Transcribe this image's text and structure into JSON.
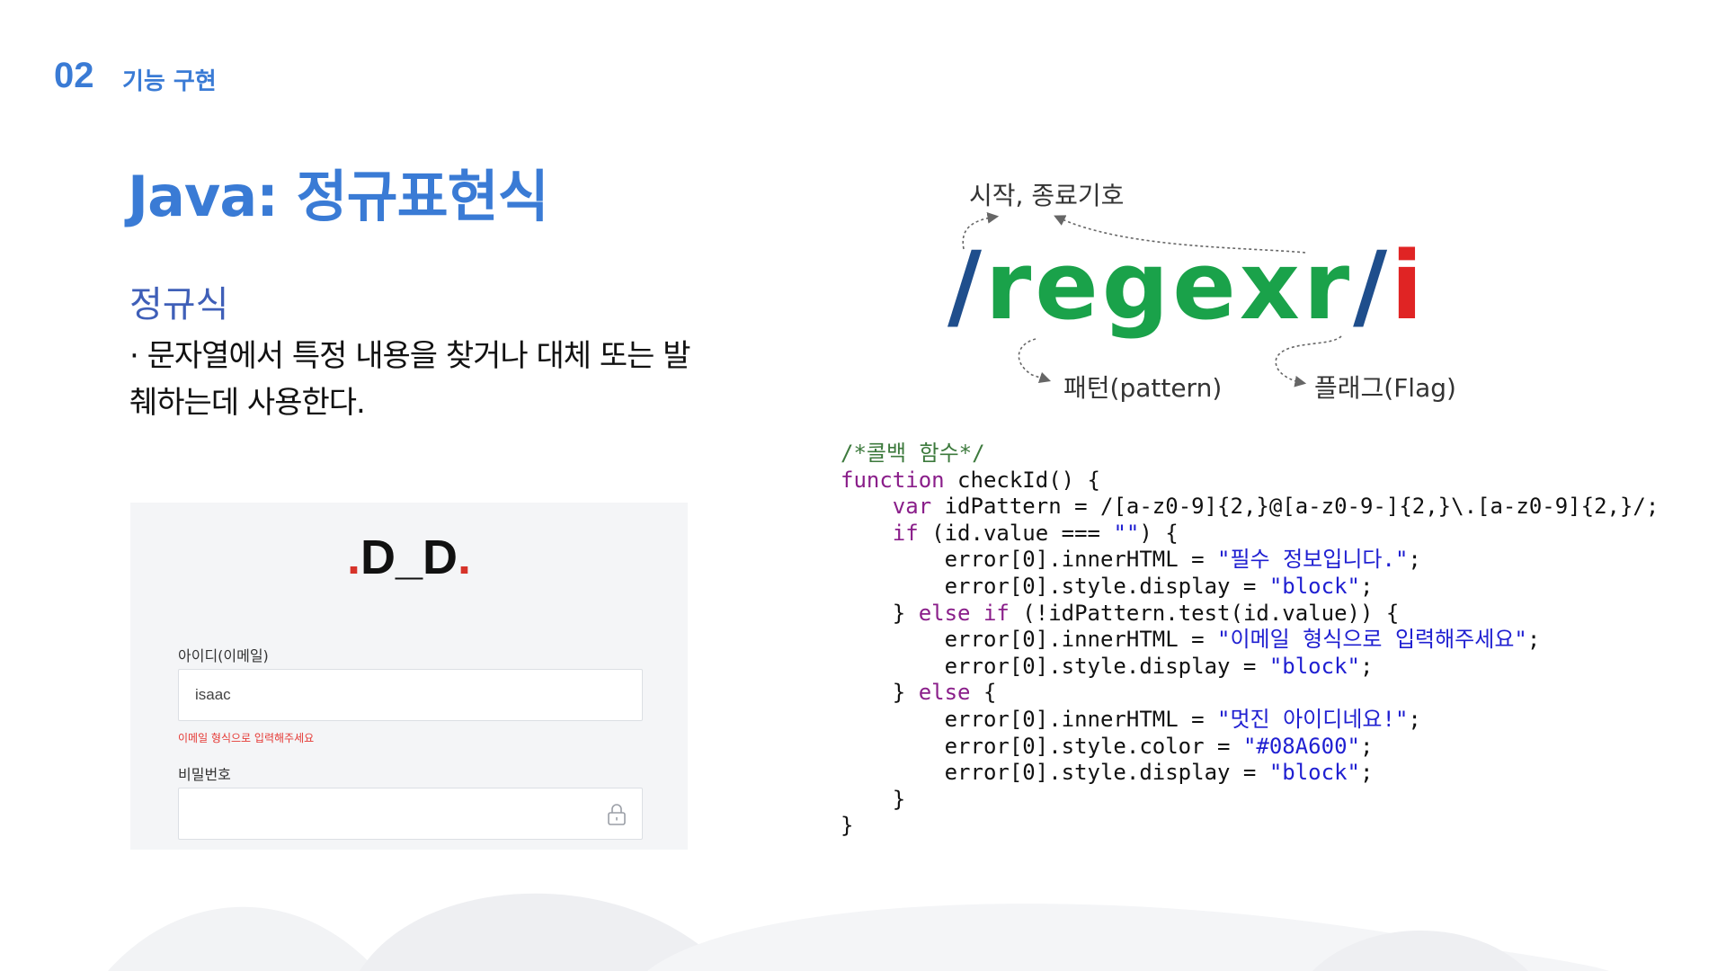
{
  "header": {
    "section_number": "02",
    "section_title": "기능 구현"
  },
  "main": {
    "title": "Java: 정규표현식",
    "subtitle": "정규식",
    "description": "· 문자열에서 특정 내용을 찾거나 대체 또는 발췌하는데 사용한다."
  },
  "login_panel": {
    "logo_left_dot": ".",
    "logo_text": "D_D",
    "logo_right_dot": ".",
    "id_label": "아이디(이메일)",
    "id_value": "isaac",
    "id_error": "이메일 형식으로 입력해주세요",
    "password_label": "비밀번호",
    "password_value": "",
    "accent_color": "#d6332a",
    "error_color": "#e53935"
  },
  "diagram": {
    "label_delimiters": "시작, 종료기호",
    "label_pattern": "패턴(pattern)",
    "label_flag": "플래그(Flag)",
    "regex_open": "/",
    "regex_body": "regexr",
    "regex_close": "/",
    "regex_flag": "i",
    "colors": {
      "slash": "#1f4e8c",
      "body": "#1aa24a",
      "flag": "#e02424"
    }
  },
  "code": {
    "lines": [
      [
        {
          "t": "/*콜백 함수*/",
          "c": "cm"
        }
      ],
      [
        {
          "t": "function",
          "c": "kw"
        },
        {
          "t": " checkId() {",
          "c": ""
        }
      ],
      [
        {
          "t": "    ",
          "c": ""
        },
        {
          "t": "var",
          "c": "kw"
        },
        {
          "t": " idPattern = /[a-z0-9]{2,}@[a-z0-9-]{2,}\\.[a-z0-9]{2,}/;",
          "c": ""
        }
      ],
      [
        {
          "t": "    ",
          "c": ""
        },
        {
          "t": "if",
          "c": "kw"
        },
        {
          "t": " (id.value === ",
          "c": ""
        },
        {
          "t": "\"\"",
          "c": "str"
        },
        {
          "t": ") {",
          "c": ""
        }
      ],
      [
        {
          "t": "        error[0].innerHTML = ",
          "c": ""
        },
        {
          "t": "\"필수 정보입니다.\"",
          "c": "str"
        },
        {
          "t": ";",
          "c": ""
        }
      ],
      [
        {
          "t": "        error[0].style.display = ",
          "c": ""
        },
        {
          "t": "\"block\"",
          "c": "str"
        },
        {
          "t": ";",
          "c": ""
        }
      ],
      [
        {
          "t": "    } ",
          "c": ""
        },
        {
          "t": "else if",
          "c": "kw"
        },
        {
          "t": " (!idPattern.test(id.value)) {",
          "c": ""
        }
      ],
      [
        {
          "t": "        error[0].innerHTML = ",
          "c": ""
        },
        {
          "t": "\"이메일 형식으로 입력해주세요\"",
          "c": "str"
        },
        {
          "t": ";",
          "c": ""
        }
      ],
      [
        {
          "t": "        error[0].style.display = ",
          "c": ""
        },
        {
          "t": "\"block\"",
          "c": "str"
        },
        {
          "t": ";",
          "c": ""
        }
      ],
      [
        {
          "t": "    } ",
          "c": ""
        },
        {
          "t": "else",
          "c": "kw"
        },
        {
          "t": " {",
          "c": ""
        }
      ],
      [
        {
          "t": "        error[0].innerHTML = ",
          "c": ""
        },
        {
          "t": "\"멋진 아이디네요!\"",
          "c": "str"
        },
        {
          "t": ";",
          "c": ""
        }
      ],
      [
        {
          "t": "        error[0].style.color = ",
          "c": ""
        },
        {
          "t": "\"#08A600\"",
          "c": "str"
        },
        {
          "t": ";",
          "c": ""
        }
      ],
      [
        {
          "t": "        error[0].style.display = ",
          "c": ""
        },
        {
          "t": "\"block\"",
          "c": "str"
        },
        {
          "t": ";",
          "c": ""
        }
      ],
      [
        {
          "t": "    }",
          "c": ""
        }
      ],
      [
        {
          "t": "}",
          "c": ""
        }
      ]
    ]
  }
}
